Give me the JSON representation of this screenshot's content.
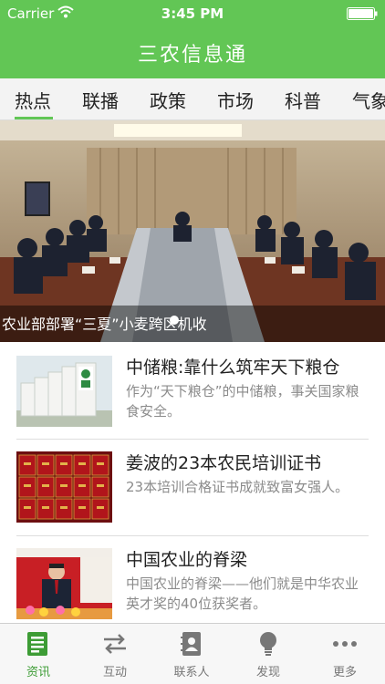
{
  "status_bar": {
    "carrier": "Carrier",
    "time": "3:45 PM"
  },
  "nav": {
    "title": "三农信息通"
  },
  "tabs": [
    {
      "label": "热点"
    },
    {
      "label": "联播"
    },
    {
      "label": "政策"
    },
    {
      "label": "市场"
    },
    {
      "label": "科普"
    },
    {
      "label": "气象"
    }
  ],
  "banner": {
    "caption": "农业部部署“三夏”小麦跨区机收"
  },
  "news": [
    {
      "title": "中储粮:靠什么筑牢天下粮仓",
      "summary": "作为“天下粮仓”的中储粮，事关国家粮食安全。"
    },
    {
      "title": "姜波的23本农民培训证书",
      "summary": "23本培训合格证书成就致富女强人。"
    },
    {
      "title": "中国农业的脊梁",
      "summary": "中国农业的脊梁——他们就是中华农业英才奖的40位获奖者。"
    }
  ],
  "tab_bar": [
    {
      "label": "资讯",
      "icon": "news-icon"
    },
    {
      "label": "互动",
      "icon": "exchange-icon"
    },
    {
      "label": "联系人",
      "icon": "contacts-icon"
    },
    {
      "label": "发现",
      "icon": "lightbulb-icon"
    },
    {
      "label": "更多",
      "icon": "more-icon"
    }
  ],
  "colors": {
    "brand": "#62c655",
    "active": "#3d9c35",
    "muted": "#8b8b8b"
  }
}
